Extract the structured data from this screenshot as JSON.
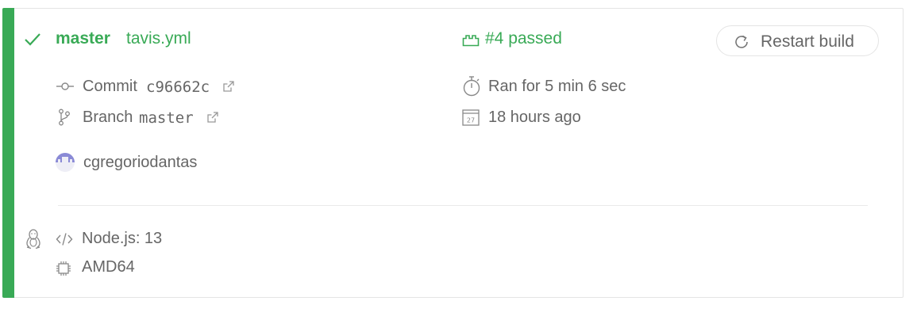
{
  "build": {
    "branch": "master",
    "file": "tavis.yml",
    "status": "#4 passed",
    "restart_label": "Restart build"
  },
  "commit": {
    "label": "Commit",
    "sha": "c96662c"
  },
  "branch": {
    "label": "Branch",
    "name": "master"
  },
  "timing": {
    "duration": "Ran for 5 min 6 sec",
    "ago": "18 hours ago",
    "calendar_day": "27"
  },
  "author": {
    "name": "cgregoriodantas"
  },
  "job": {
    "language": "Node.js: 13",
    "arch": "AMD64",
    "os_icon": "linux-tux-icon"
  },
  "colors": {
    "passed": "#39aa56",
    "text": "#666666",
    "border": "#e4e4e4"
  }
}
